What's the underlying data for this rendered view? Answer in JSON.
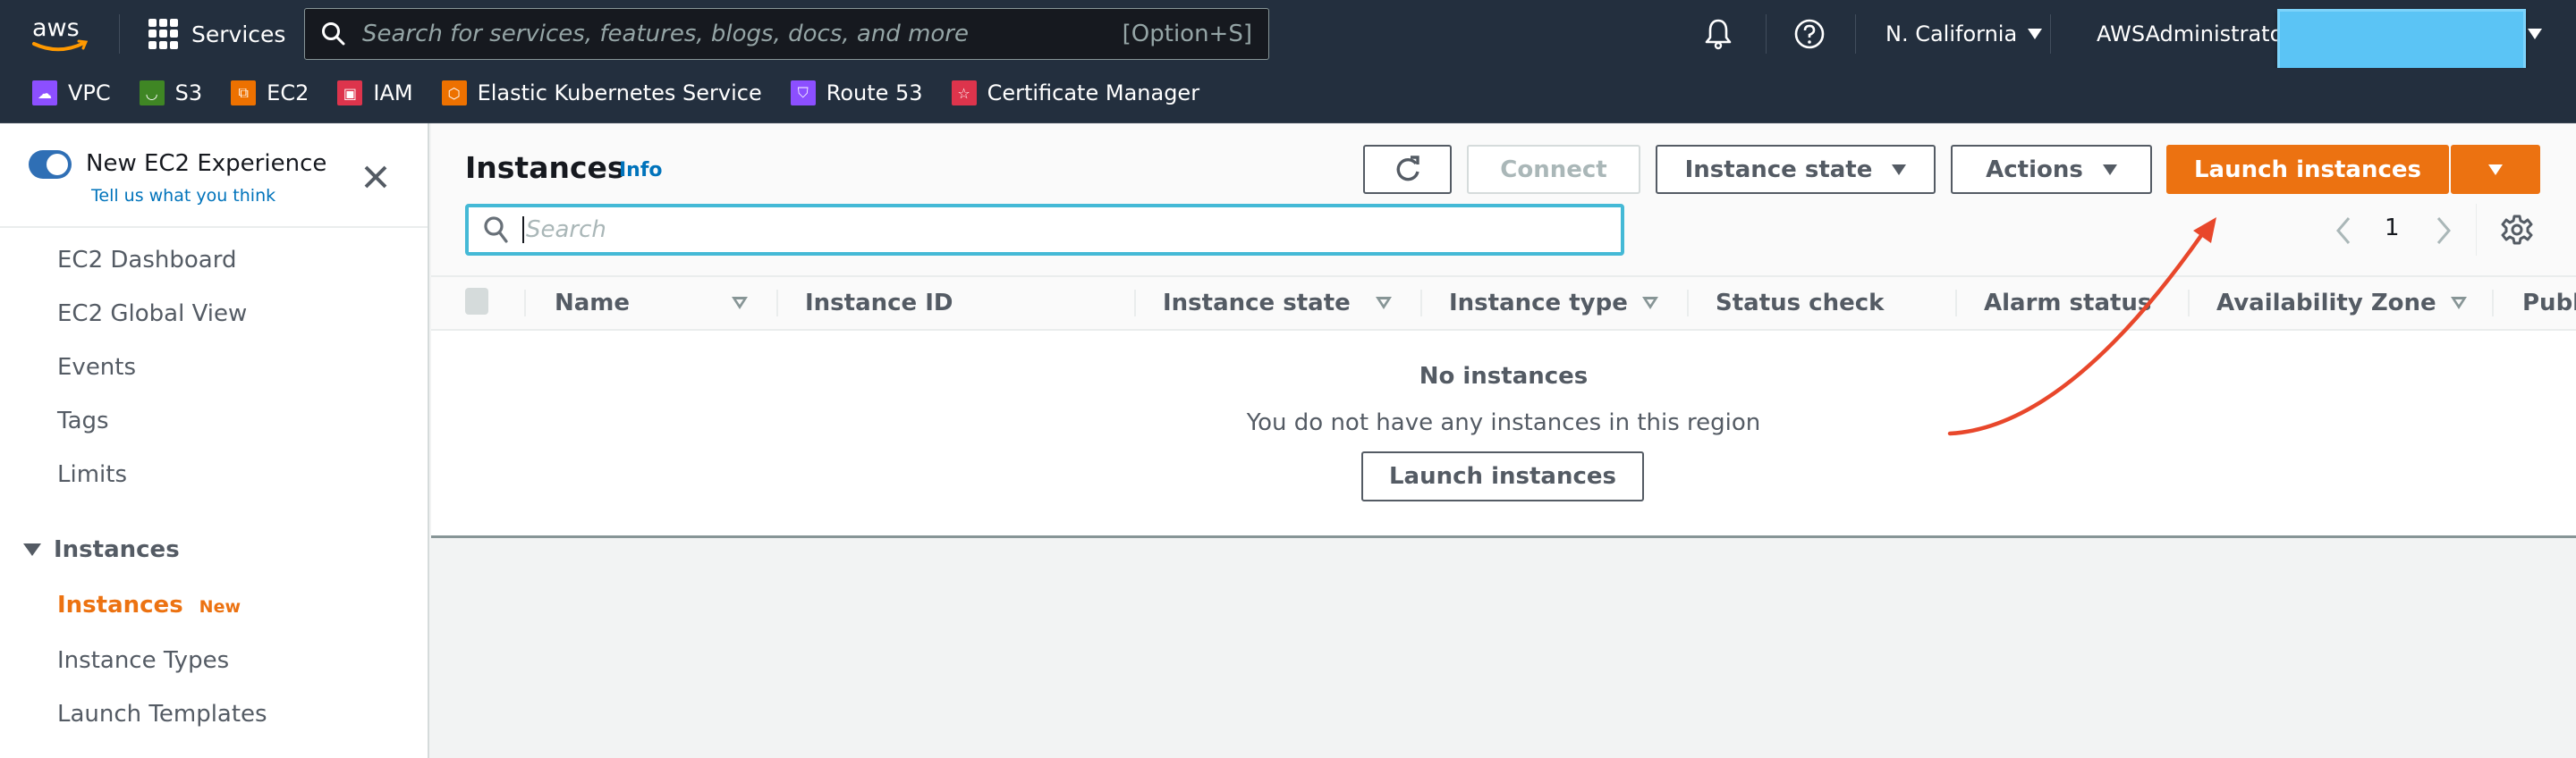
{
  "topbar": {
    "logo": "aws",
    "services_label": "Services",
    "search_placeholder": "Search for services, features, blogs, docs, and more",
    "search_shortcut": "[Option+S]",
    "region": "N. California",
    "account": "AWSAdministrator",
    "icons": [
      "bell-icon",
      "help-icon"
    ]
  },
  "favorites": [
    {
      "label": "VPC",
      "icon": "vpc-icon",
      "color": "#8c4fff"
    },
    {
      "label": "S3",
      "icon": "s3-icon",
      "color": "#3f8624"
    },
    {
      "label": "EC2",
      "icon": "ec2-icon",
      "color": "#ed7100"
    },
    {
      "label": "IAM",
      "icon": "iam-icon",
      "color": "#dd344c"
    },
    {
      "label": "Elastic Kubernetes Service",
      "icon": "eks-icon",
      "color": "#ed7100"
    },
    {
      "label": "Route 53",
      "icon": "route53-icon",
      "color": "#8c4fff"
    },
    {
      "label": "Certificate Manager",
      "icon": "acm-icon",
      "color": "#dd344c"
    }
  ],
  "sidebar": {
    "experience_label": "New EC2 Experience",
    "feedback_link": "Tell us what you think",
    "toggle_on": true,
    "items": [
      "EC2 Dashboard",
      "EC2 Global View",
      "Events",
      "Tags",
      "Limits"
    ],
    "group_label": "Instances",
    "group_items": [
      {
        "label": "Instances",
        "badge": "New",
        "active": true
      },
      {
        "label": "Instance Types"
      },
      {
        "label": "Launch Templates"
      }
    ]
  },
  "main": {
    "title": "Instances",
    "info": "Info",
    "buttons": {
      "connect": "Connect",
      "instance_state": "Instance state",
      "actions": "Actions",
      "launch": "Launch instances"
    },
    "search_placeholder": "Search",
    "page": "1",
    "columns": [
      {
        "label": "Name",
        "filter": true
      },
      {
        "label": "Instance ID",
        "filter": false
      },
      {
        "label": "Instance state",
        "filter": true
      },
      {
        "label": "Instance type",
        "filter": true
      },
      {
        "label": "Status check",
        "filter": false
      },
      {
        "label": "Alarm status",
        "filter": false
      },
      {
        "label": "Availability Zone",
        "filter": true
      },
      {
        "label": "Publ",
        "filter": false
      }
    ],
    "empty": {
      "title": "No instances",
      "text": "You do not have any instances in this region",
      "button": "Launch instances"
    }
  },
  "colors": {
    "header_bg": "#232f3e",
    "primary": "#ec7211",
    "link": "#0073bb",
    "annotation_arrow": "#e8472b"
  }
}
